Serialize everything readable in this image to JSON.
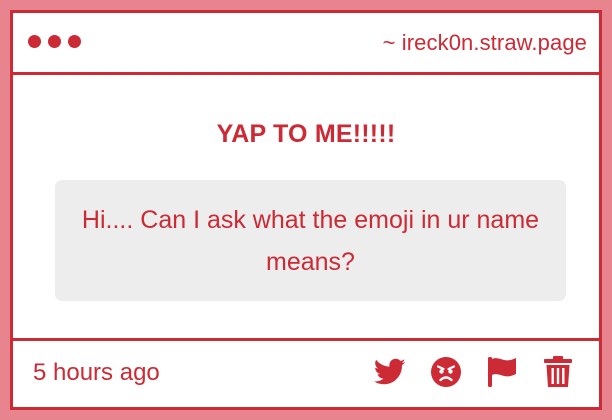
{
  "window": {
    "url": "~ ireck0n.straw.page"
  },
  "post": {
    "heading": "YAP TO ME!!!!!",
    "message": "Hi.... Can I ask what the emoji in ur name means?",
    "timestamp": "5 hours ago"
  },
  "actions": [
    {
      "icon": "twitter-icon"
    },
    {
      "icon": "angry-face-icon"
    },
    {
      "icon": "flag-icon"
    },
    {
      "icon": "trash-icon"
    }
  ],
  "colors": {
    "accent": "#cc2a35",
    "background": "#e8848d",
    "message_bg": "#ededed"
  }
}
